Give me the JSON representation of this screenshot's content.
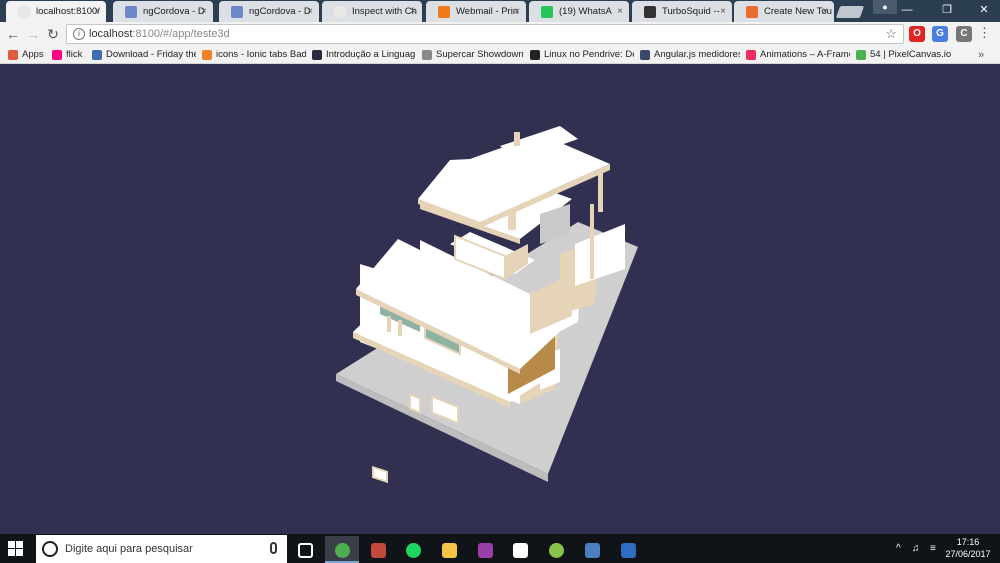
{
  "tabs": [
    {
      "title": "localhost:8100/",
      "active": true,
      "color": "#e8e8e8"
    },
    {
      "title": "ngCordova - D",
      "active": false,
      "color": "#6d88c4"
    },
    {
      "title": "ngCordova - D",
      "active": false,
      "color": "#6d88c4"
    },
    {
      "title": "Inspect with Ch",
      "active": false,
      "color": "#e8e8e8"
    },
    {
      "title": "Webmail - Prin",
      "active": false,
      "color": "#f07a1a"
    },
    {
      "title": "(19) WhatsA",
      "active": false,
      "color": "#25c65a"
    },
    {
      "title": "TurboSquid --",
      "active": false,
      "color": "#333333"
    },
    {
      "title": "Create New Tou",
      "active": false,
      "color": "#e96c2c"
    }
  ],
  "window": {
    "minimize": "—",
    "maximize": "❐",
    "close": "✕",
    "profile_icon": "person-icon"
  },
  "address": {
    "host": "localhost",
    "path": ":8100/#/app/teste3d"
  },
  "extensions": [
    {
      "name": "opera-icon",
      "glyph": "O",
      "color": "#e22424"
    },
    {
      "name": "translate-icon",
      "glyph": "G",
      "color": "#4a7fe0"
    },
    {
      "name": "extension-icon",
      "glyph": "C",
      "color": "#777777"
    }
  ],
  "bookmarks": [
    {
      "label": "Apps",
      "color": "#e25b3c"
    },
    {
      "label": "flick",
      "color": "#ff0084"
    },
    {
      "label": "Download - Friday the",
      "color": "#3d6fb0"
    },
    {
      "label": "icons - Ionic tabs Badg",
      "color": "#f48024"
    },
    {
      "label": "Introdução a Linguag",
      "color": "#2a2a40"
    },
    {
      "label": "Supercar Showdown -",
      "color": "#888888"
    },
    {
      "label": "Linux no Pendrive: De",
      "color": "#222222"
    },
    {
      "label": "Angular.js medidores",
      "color": "#3a4a6b"
    },
    {
      "label": "Animations – A-Frame",
      "color": "#ef2d5e"
    },
    {
      "label": "54 | PixelCanvas.io",
      "color": "#4caf50"
    }
  ],
  "bookmarks_more": "»",
  "scene": {
    "background": "#313050",
    "ground": "#cfcfcf",
    "walls": "#ffffff",
    "accent": "#e6d4b8",
    "glass": "#8fb3a3",
    "wood": "#b88a4a"
  },
  "taskbar": {
    "search_placeholder": "Digite aqui para pesquisar",
    "apps": [
      {
        "name": "task-view-icon",
        "color": "#ffffff"
      },
      {
        "name": "chrome-icon",
        "color": "#4caf50",
        "active": true
      },
      {
        "name": "photo-app-icon",
        "color": "#c24a3a"
      },
      {
        "name": "spotify-icon",
        "color": "#1ed760"
      },
      {
        "name": "file-explorer-icon",
        "color": "#f6c445"
      },
      {
        "name": "winrar-icon",
        "color": "#9b3fa8"
      },
      {
        "name": "mail-icon",
        "color": "#ffffff"
      },
      {
        "name": "android-icon",
        "color": "#8bc34a"
      },
      {
        "name": "virtualbox-icon",
        "color": "#4a7fc1"
      },
      {
        "name": "powershell-icon",
        "color": "#2f6dc4"
      }
    ],
    "tray": {
      "chevron": "^",
      "volume": "♫",
      "wifi": "≡"
    },
    "time": "17:16",
    "date": "27/06/2017"
  }
}
